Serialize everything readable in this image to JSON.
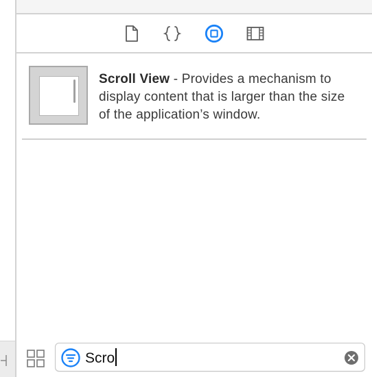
{
  "toolbar": {
    "tabs": [
      {
        "icon": "file-template-icon",
        "selected": false
      },
      {
        "icon": "code-snippet-icon",
        "selected": false
      },
      {
        "icon": "object-library-icon",
        "selected": true
      },
      {
        "icon": "media-library-icon",
        "selected": false
      }
    ]
  },
  "library": {
    "items": [
      {
        "title": "Scroll View",
        "separator": " - ",
        "description": "Provides a mechanism to display content that is larger than the size of the application’s window."
      }
    ]
  },
  "filter": {
    "value": "Scro",
    "icon": "filter-icon",
    "clear_icon": "clear-icon"
  },
  "colors": {
    "accent": "#1a82f7",
    "separator": "#d2d2d2",
    "thumb_fill": "#d4d4d4"
  }
}
